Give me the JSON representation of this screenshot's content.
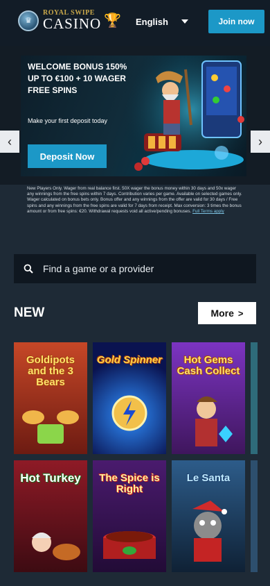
{
  "header": {
    "logo_top": "ROYAL SWIPE",
    "logo_bottom": "CASINO",
    "language": "English",
    "join_label": "Join now"
  },
  "banner": {
    "title": "WELCOME BONUS 150% UP TO €100 + 10 WAGER FREE SPINS",
    "subtitle": "Make your first deposit today",
    "cta_label": "Deposit Now",
    "prev_icon": "chevron-left-icon",
    "next_icon": "chevron-right-icon"
  },
  "terms": {
    "text": "New Players Only. Wager from real balance first. 50X wager the bonus money within 30 days and 50x wager any winnings from the free spins within 7 days. Contribution varies per game. Available on selected games only. Wager calculated on bonus bets only. Bonus offer and any winnings from the offer are valid for 30 days / Free spins and any winnings from the free spins are valid for 7 days from receipt. Max conversion: 3 times the bonus amount or from free spins: €20. Withdrawal requests void all active/pending bonuses.",
    "link_label": "Full Terms apply"
  },
  "search": {
    "placeholder": "Find a game or a provider",
    "icon": "search-icon"
  },
  "new_section": {
    "title": "NEW",
    "more_label": "More",
    "games": [
      {
        "name": "Goldipots and the 3 Bears",
        "color": "#8b2b1f"
      },
      {
        "name": "Gold Spinner",
        "color": "#0f1f6b"
      },
      {
        "name": "Hot Gems Cash Collect",
        "color": "#6a2ca8"
      },
      {
        "name": "Hot Turkey",
        "color": "#7b1420"
      },
      {
        "name": "The Spice is Right",
        "color": "#3b1556"
      },
      {
        "name": "Le Santa",
        "color": "#1d3d63"
      }
    ]
  }
}
